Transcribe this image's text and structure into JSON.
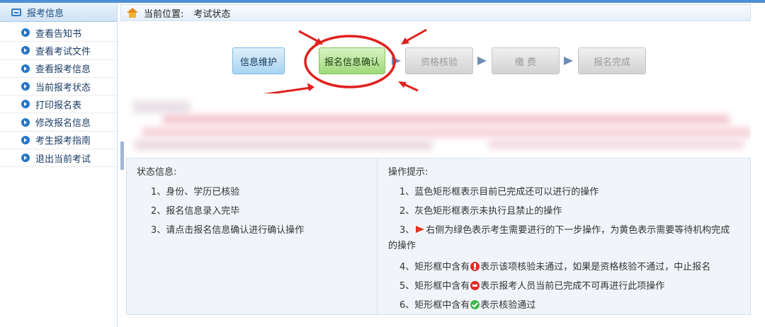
{
  "sidebar": {
    "header": "报考信息",
    "items": [
      {
        "label": "查看告知书"
      },
      {
        "label": "查看考试文件"
      },
      {
        "label": "查看报考信息"
      },
      {
        "label": "当前报考状态"
      },
      {
        "label": "打印报名表"
      },
      {
        "label": "修改报名信息"
      },
      {
        "label": "考生报考指南"
      },
      {
        "label": "退出当前考试"
      }
    ]
  },
  "breadcrumb": {
    "prefix": "当前位置:",
    "current": "考试状态"
  },
  "steps": [
    {
      "label": "信息维护",
      "state": "blue"
    },
    {
      "label": "报名信息确认",
      "state": "green"
    },
    {
      "label": "资格核验",
      "state": "gray"
    },
    {
      "label": "缴 费",
      "state": "gray"
    },
    {
      "label": "报名完成",
      "state": "gray"
    }
  ],
  "status": {
    "title": "状态信息:",
    "lines": [
      "1、身份、学历已核验",
      "2、报名信息录入完毕",
      "3、请点击报名信息确认进行确认操作"
    ]
  },
  "tips": {
    "title": "操作提示:",
    "line1": "1、蓝色矩形框表示目前已完成还可以进行的操作",
    "line2": "2、灰色矩形框表示未执行且禁止的操作",
    "line3_a": "3、",
    "line3_b": "右侧为绿色表示考生需要进行的下一步操作，为黄色表示需要等待机构完成",
    "line3_c": "的操作",
    "line4_a": "4、矩形框中含有",
    "line4_b": "表示该项核验未通过，如果是资格核验不通过，中止报名",
    "line5_a": "5、矩形框中含有",
    "line5_b": "表示报考人员当前已完成不可再进行此项操作",
    "line6_a": "6、矩形框中含有",
    "line6_b": "表示核验通过"
  },
  "colors": {
    "accent": "#4d8fd6",
    "step_blue": "#a8d3f1",
    "step_green": "#9fd97a",
    "step_gray": "#d2d2d2",
    "annotation_red": "#e0201c"
  }
}
